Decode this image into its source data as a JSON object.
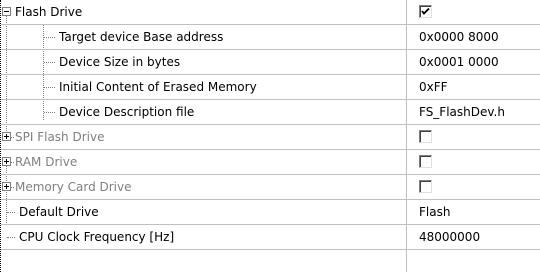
{
  "rows": [
    {
      "name": "Flash Drive",
      "checked": true
    },
    {
      "name": "Target device Base address",
      "value": "0x0000 8000"
    },
    {
      "name": "Device Size in bytes",
      "value": "0x0001 0000"
    },
    {
      "name": "Initial Content of Erased Memory",
      "value": "0xFF"
    },
    {
      "name": "Device Description file",
      "value": "FS_FlashDev.h"
    },
    {
      "name": "SPI Flash Drive",
      "checked": false
    },
    {
      "name": "RAM Drive",
      "checked": false
    },
    {
      "name": "Memory Card Drive",
      "checked": false
    },
    {
      "name": "Default Drive",
      "value": "Flash"
    },
    {
      "name": "CPU Clock Frequency [Hz]",
      "value": "48000000"
    }
  ],
  "icons": {
    "expanded": "collapse-minus-icon",
    "collapsed": "expand-plus-icon",
    "check": "checkmark-icon"
  },
  "colors": {
    "grid_line": "#c0c0c0",
    "disabled_text": "#808080"
  }
}
